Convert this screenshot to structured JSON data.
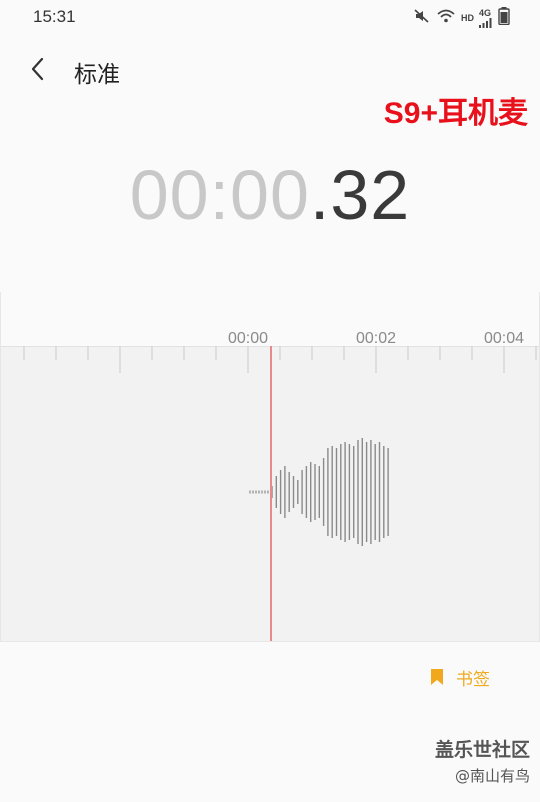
{
  "status_bar": {
    "time": "15:31",
    "hd_label": "HD",
    "network_label": "4G",
    "icons": [
      "mute-icon",
      "wifi-icon",
      "signal-icon",
      "battery-icon"
    ]
  },
  "header": {
    "title": "标准",
    "back_icon": "chevron-left-icon"
  },
  "overlay_label": "S9+耳机麦",
  "timer": {
    "minutes_seconds": "00:00",
    "fraction": ".32"
  },
  "timeline": {
    "tick_labels": [
      "00:00",
      "00:02",
      "00:04"
    ]
  },
  "bookmark": {
    "label": "书签",
    "icon": "bookmark-icon",
    "color": "#f0a91c"
  },
  "watermark": {
    "title": "盖乐世社区",
    "subtitle": "@南山有鸟"
  },
  "colors": {
    "accent_red": "#e8111b",
    "playhead": "#e98a8a",
    "bookmark": "#f0a91c"
  }
}
